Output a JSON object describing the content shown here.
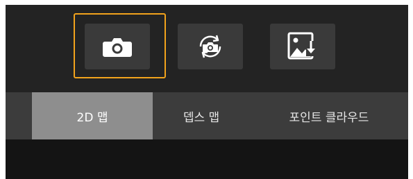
{
  "toolbar": {
    "buttons": [
      {
        "icon": "camera-icon",
        "selected": true
      },
      {
        "icon": "camera-rotate-icon",
        "selected": false
      },
      {
        "icon": "image-download-icon",
        "selected": false
      }
    ],
    "selection_color": "#f2a31c"
  },
  "tabs": {
    "items": [
      {
        "label": "2D 맵",
        "active": true
      },
      {
        "label": "뎁스 맵",
        "active": false
      },
      {
        "label": "포인트 클라우드",
        "active": false
      }
    ]
  }
}
